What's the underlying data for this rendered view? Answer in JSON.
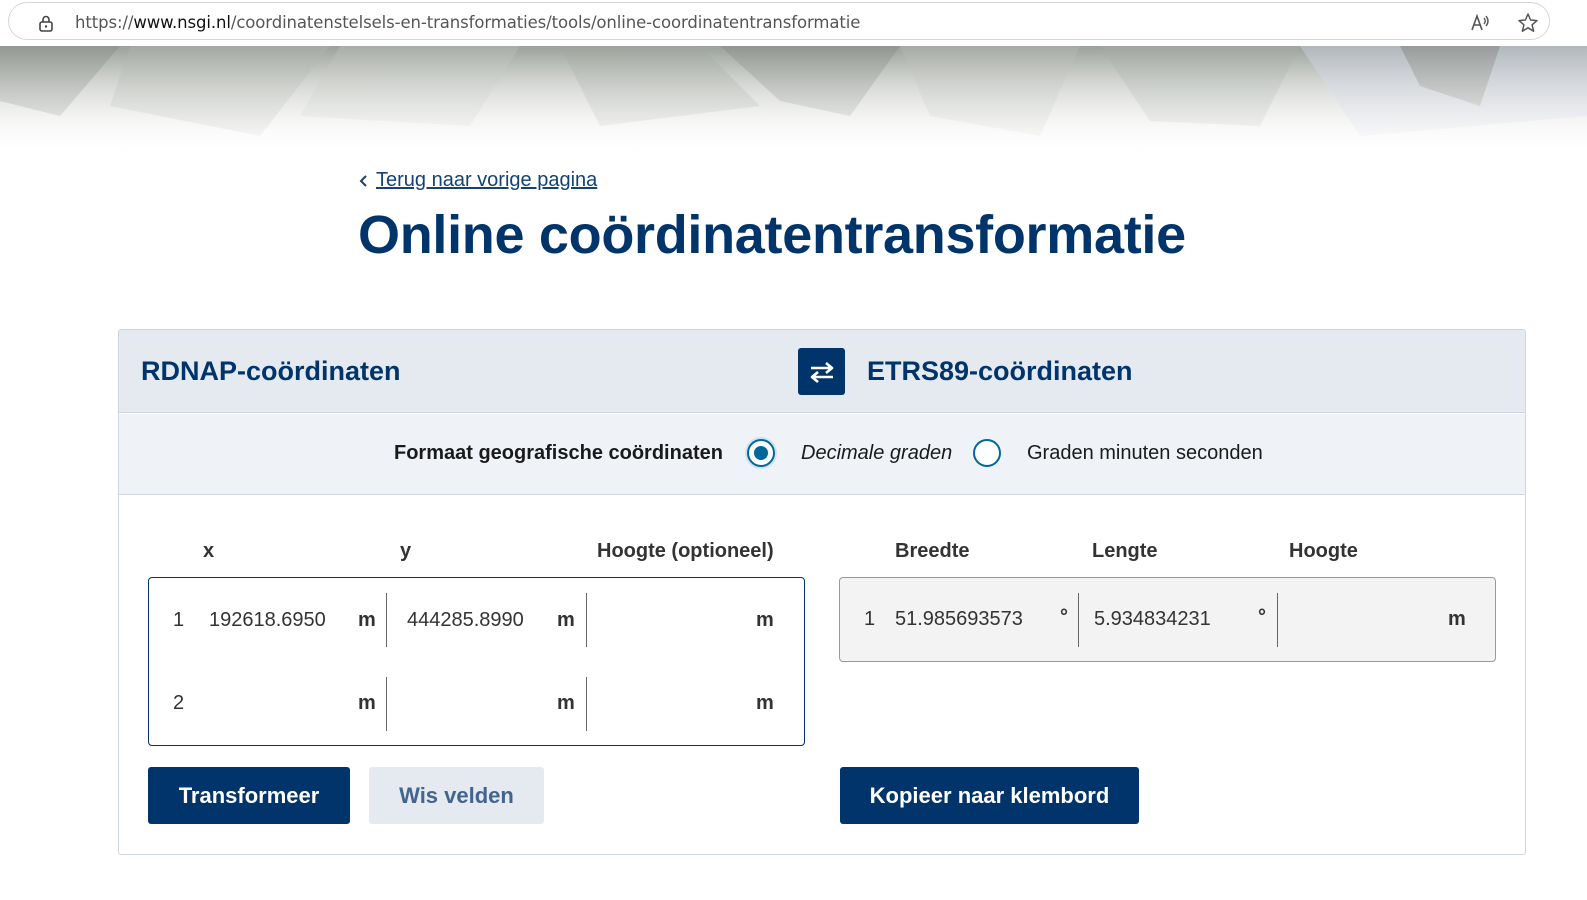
{
  "browser": {
    "url_prefix": "https://",
    "url_domain": "www.nsgi.nl",
    "url_path": "/coordinatenstelsels-en-transformaties/tools/online-coordinatentransformatie"
  },
  "page": {
    "back_link": "Terug naar vorige pagina",
    "title": "Online coördinatentransformatie"
  },
  "card": {
    "source_title": "RDNAP-coördinaten",
    "target_title": "ETRS89-coördinaten",
    "format": {
      "label": "Formaat geografische coördinaten",
      "options": [
        "Decimale graden",
        "Graden minuten seconden"
      ],
      "selected": "Decimale graden"
    },
    "input": {
      "headers": [
        "x",
        "y",
        "Hoogte (optioneel)"
      ],
      "unit": "m",
      "rows": [
        {
          "num": "1",
          "x": "192618.6950",
          "y": "444285.8990",
          "h": ""
        },
        {
          "num": "2",
          "x": "",
          "y": "",
          "h": ""
        }
      ]
    },
    "output": {
      "headers": [
        "Breedte",
        "Lengte",
        "Hoogte"
      ],
      "deg_unit": "°",
      "h_unit": "m",
      "rows": [
        {
          "num": "1",
          "lat": "51.985693573",
          "lon": "5.934834231",
          "h": ""
        }
      ]
    },
    "buttons": {
      "transform": "Transformeer",
      "clear": "Wis velden",
      "copy": "Kopieer naar klembord"
    }
  },
  "colors": {
    "primary": "#01346b",
    "header_bg": "#e5eaf1",
    "radio": "#01689b"
  }
}
